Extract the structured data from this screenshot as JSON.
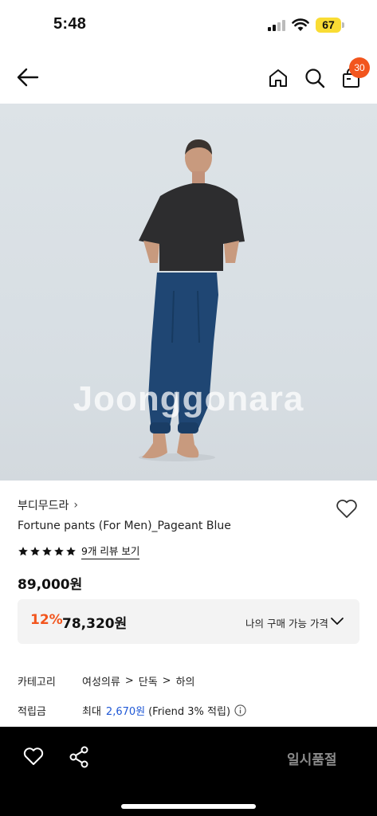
{
  "status_bar": {
    "time": "5:48",
    "battery": "67"
  },
  "nav": {
    "cart_count": "30"
  },
  "image": {
    "watermark": "Joonggonara"
  },
  "product": {
    "brand": "부디무드라",
    "brand_chevron": "›",
    "title": "Fortune pants (For Men)_Pageant Blue",
    "rating_stars": 5,
    "review_link": "9개 리뷰 보기",
    "price": "89,000원",
    "discount_rate": "12%",
    "discount_price": "78,320원",
    "my_price_label": "나의 구매 가능 가격"
  },
  "details": {
    "category_label": "카테고리",
    "category_path": [
      "여성의류",
      "단독",
      "하의"
    ],
    "category_sep": ">",
    "points_label": "적립금",
    "points_prefix": "최대",
    "points_amount": "2,670원",
    "points_note": "(Friend 3% 적립)"
  },
  "bottom": {
    "soldout_label": "일시품절"
  },
  "colors": {
    "accent": "#f2551d",
    "link_blue": "#1f58d6",
    "battery": "#f9dc34"
  }
}
